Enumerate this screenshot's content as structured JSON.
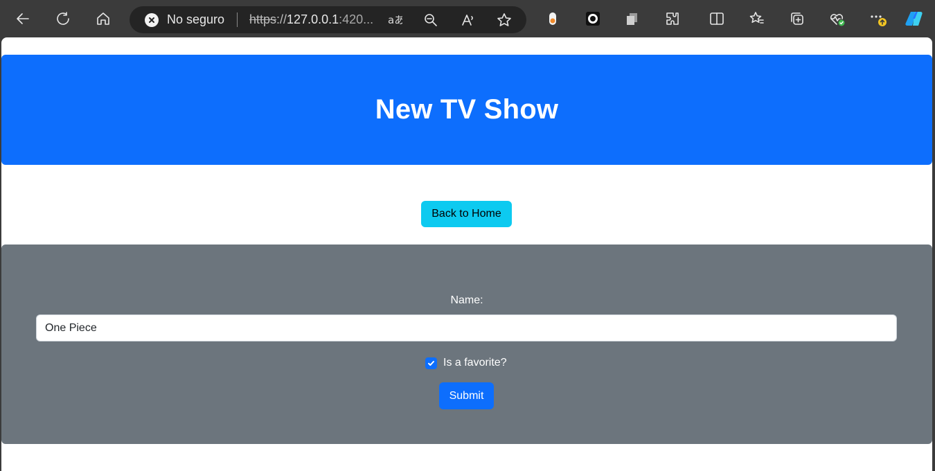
{
  "browser": {
    "insecure_label": "No seguro",
    "url_scheme": "https",
    "url_separator": "://",
    "url_host": "127.0.0.1",
    "url_port_truncated": ":420...",
    "icons": [
      "back-arrow-icon",
      "refresh-icon",
      "home-icon",
      "insecure-icon",
      "translate-icon",
      "zoom-out-icon",
      "read-aloud-icon",
      "favorite-star-icon",
      "extension-orange-icon",
      "github-icon",
      "extension-pages-icon",
      "extensions-icon",
      "split-screen-icon",
      "favorites-icon",
      "collections-icon",
      "browser-health-icon",
      "more-options-icon",
      "copilot-icon"
    ]
  },
  "page": {
    "title": "New TV Show",
    "back_button_label": "Back to Home",
    "form": {
      "name_label": "Name:",
      "name_value": "One Piece",
      "favorite_label": "Is a favorite?",
      "favorite_checked": true,
      "submit_label": "Submit"
    }
  },
  "colors": {
    "primary": "#0d6efd",
    "info": "#0dcaf0",
    "secondary": "#6c757d"
  }
}
